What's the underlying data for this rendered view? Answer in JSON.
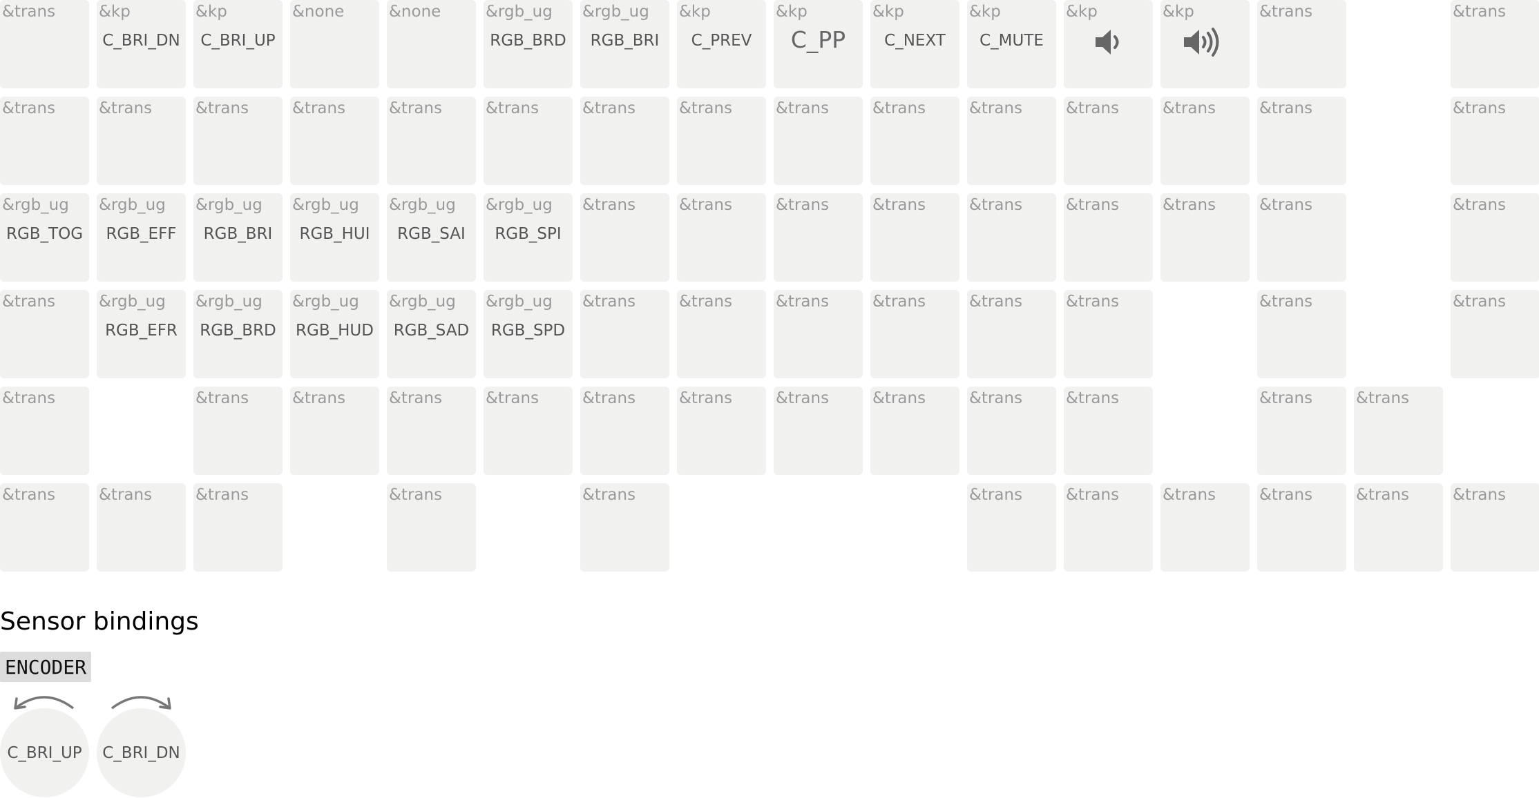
{
  "keymap": {
    "rows": [
      [
        {
          "col": 0,
          "behavior": "&trans",
          "param": ""
        },
        {
          "col": 1,
          "behavior": "&kp",
          "param": "C_BRI_DN"
        },
        {
          "col": 2,
          "behavior": "&kp",
          "param": "C_BRI_UP"
        },
        {
          "col": 3,
          "behavior": "&none",
          "param": ""
        },
        {
          "col": 4,
          "behavior": "&none",
          "param": ""
        },
        {
          "col": 5,
          "behavior": "&rgb_ug",
          "param": "RGB_BRD"
        },
        {
          "col": 6,
          "behavior": "&rgb_ug",
          "param": "RGB_BRI"
        },
        {
          "col": 7,
          "behavior": "&kp",
          "param": "C_PREV"
        },
        {
          "col": 8,
          "behavior": "&kp",
          "param": "C_PP",
          "big": true
        },
        {
          "col": 9,
          "behavior": "&kp",
          "param": "C_NEXT"
        },
        {
          "col": 10,
          "behavior": "&kp",
          "param": "C_MUTE"
        },
        {
          "col": 11,
          "behavior": "&kp",
          "param": "",
          "icon": "volume-down-icon"
        },
        {
          "col": 12,
          "behavior": "&kp",
          "param": "",
          "icon": "volume-up-icon"
        },
        {
          "col": 13,
          "behavior": "&trans",
          "param": ""
        },
        {
          "col": 15,
          "behavior": "&trans",
          "param": ""
        }
      ],
      [
        {
          "col": 0,
          "behavior": "&trans",
          "param": ""
        },
        {
          "col": 1,
          "behavior": "&trans",
          "param": ""
        },
        {
          "col": 2,
          "behavior": "&trans",
          "param": ""
        },
        {
          "col": 3,
          "behavior": "&trans",
          "param": ""
        },
        {
          "col": 4,
          "behavior": "&trans",
          "param": ""
        },
        {
          "col": 5,
          "behavior": "&trans",
          "param": ""
        },
        {
          "col": 6,
          "behavior": "&trans",
          "param": ""
        },
        {
          "col": 7,
          "behavior": "&trans",
          "param": ""
        },
        {
          "col": 8,
          "behavior": "&trans",
          "param": ""
        },
        {
          "col": 9,
          "behavior": "&trans",
          "param": ""
        },
        {
          "col": 10,
          "behavior": "&trans",
          "param": ""
        },
        {
          "col": 11,
          "behavior": "&trans",
          "param": ""
        },
        {
          "col": 12,
          "behavior": "&trans",
          "param": ""
        },
        {
          "col": 13,
          "behavior": "&trans",
          "param": ""
        },
        {
          "col": 15,
          "behavior": "&trans",
          "param": ""
        }
      ],
      [
        {
          "col": 0,
          "behavior": "&rgb_ug",
          "param": "RGB_TOG"
        },
        {
          "col": 1,
          "behavior": "&rgb_ug",
          "param": "RGB_EFF"
        },
        {
          "col": 2,
          "behavior": "&rgb_ug",
          "param": "RGB_BRI"
        },
        {
          "col": 3,
          "behavior": "&rgb_ug",
          "param": "RGB_HUI"
        },
        {
          "col": 4,
          "behavior": "&rgb_ug",
          "param": "RGB_SAI"
        },
        {
          "col": 5,
          "behavior": "&rgb_ug",
          "param": "RGB_SPI"
        },
        {
          "col": 6,
          "behavior": "&trans",
          "param": ""
        },
        {
          "col": 7,
          "behavior": "&trans",
          "param": ""
        },
        {
          "col": 8,
          "behavior": "&trans",
          "param": ""
        },
        {
          "col": 9,
          "behavior": "&trans",
          "param": ""
        },
        {
          "col": 10,
          "behavior": "&trans",
          "param": ""
        },
        {
          "col": 11,
          "behavior": "&trans",
          "param": ""
        },
        {
          "col": 12,
          "behavior": "&trans",
          "param": ""
        },
        {
          "col": 13,
          "behavior": "&trans",
          "param": ""
        },
        {
          "col": 15,
          "behavior": "&trans",
          "param": ""
        }
      ],
      [
        {
          "col": 0,
          "behavior": "&trans",
          "param": ""
        },
        {
          "col": 1,
          "behavior": "&rgb_ug",
          "param": "RGB_EFR"
        },
        {
          "col": 2,
          "behavior": "&rgb_ug",
          "param": "RGB_BRD"
        },
        {
          "col": 3,
          "behavior": "&rgb_ug",
          "param": "RGB_HUD"
        },
        {
          "col": 4,
          "behavior": "&rgb_ug",
          "param": "RGB_SAD"
        },
        {
          "col": 5,
          "behavior": "&rgb_ug",
          "param": "RGB_SPD"
        },
        {
          "col": 6,
          "behavior": "&trans",
          "param": ""
        },
        {
          "col": 7,
          "behavior": "&trans",
          "param": ""
        },
        {
          "col": 8,
          "behavior": "&trans",
          "param": ""
        },
        {
          "col": 9,
          "behavior": "&trans",
          "param": ""
        },
        {
          "col": 10,
          "behavior": "&trans",
          "param": ""
        },
        {
          "col": 11,
          "behavior": "&trans",
          "param": ""
        },
        {
          "col": 13,
          "behavior": "&trans",
          "param": ""
        },
        {
          "col": 15,
          "behavior": "&trans",
          "param": ""
        }
      ],
      [
        {
          "col": 0,
          "behavior": "&trans",
          "param": ""
        },
        {
          "col": 2,
          "behavior": "&trans",
          "param": ""
        },
        {
          "col": 3,
          "behavior": "&trans",
          "param": ""
        },
        {
          "col": 4,
          "behavior": "&trans",
          "param": ""
        },
        {
          "col": 5,
          "behavior": "&trans",
          "param": ""
        },
        {
          "col": 6,
          "behavior": "&trans",
          "param": ""
        },
        {
          "col": 7,
          "behavior": "&trans",
          "param": ""
        },
        {
          "col": 8,
          "behavior": "&trans",
          "param": ""
        },
        {
          "col": 9,
          "behavior": "&trans",
          "param": ""
        },
        {
          "col": 10,
          "behavior": "&trans",
          "param": ""
        },
        {
          "col": 11,
          "behavior": "&trans",
          "param": ""
        },
        {
          "col": 13,
          "behavior": "&trans",
          "param": ""
        },
        {
          "col": 14,
          "behavior": "&trans",
          "param": ""
        }
      ],
      [
        {
          "col": 0,
          "behavior": "&trans",
          "param": ""
        },
        {
          "col": 1,
          "behavior": "&trans",
          "param": ""
        },
        {
          "col": 2,
          "behavior": "&trans",
          "param": ""
        },
        {
          "col": 4,
          "behavior": "&trans",
          "param": ""
        },
        {
          "col": 6,
          "behavior": "&trans",
          "param": ""
        },
        {
          "col": 10,
          "behavior": "&trans",
          "param": ""
        },
        {
          "col": 11,
          "behavior": "&trans",
          "param": ""
        },
        {
          "col": 12,
          "behavior": "&trans",
          "param": ""
        },
        {
          "col": 13,
          "behavior": "&trans",
          "param": ""
        },
        {
          "col": 14,
          "behavior": "&trans",
          "param": ""
        },
        {
          "col": 15,
          "behavior": "&trans",
          "param": ""
        }
      ]
    ]
  },
  "sensor": {
    "title": "Sensor bindings",
    "encoder_label": "ENCODER",
    "knobs": [
      {
        "label": "C_BRI_UP",
        "direction": "counter-clockwise"
      },
      {
        "label": "C_BRI_DN",
        "direction": "clockwise"
      }
    ]
  },
  "colors": {
    "key_bg": "#f1f1f0",
    "behavior_text": "#9a9a9a",
    "param_text": "#555555",
    "encoder_bg": "#dcdcdc"
  }
}
